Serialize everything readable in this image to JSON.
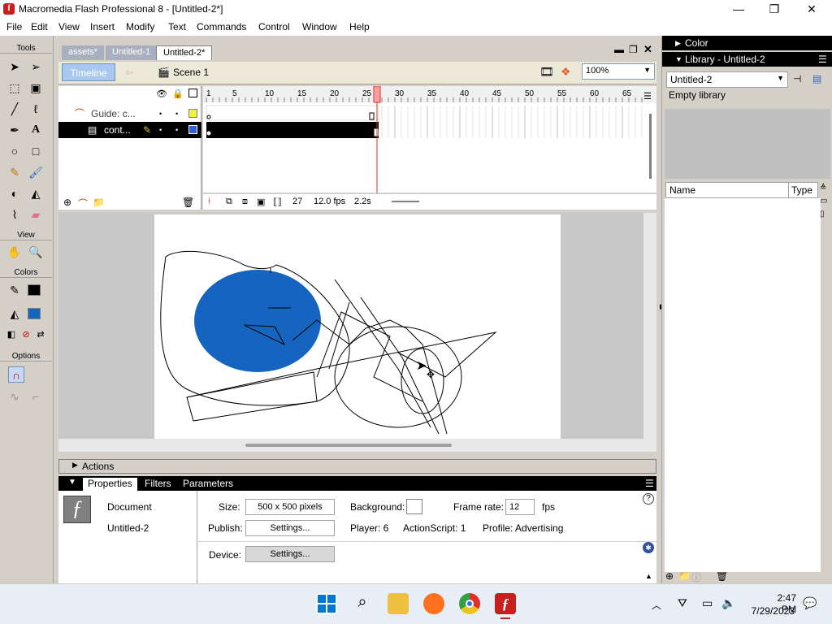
{
  "window": {
    "title": "Macromedia Flash Professional 8 - [Untitled-2*]",
    "minimize": "—",
    "maximize": "❐",
    "close": "✕"
  },
  "menu": [
    "File",
    "Edit",
    "View",
    "Insert",
    "Modify",
    "Text",
    "Commands",
    "Control",
    "Window",
    "Help"
  ],
  "tools": {
    "header": "Tools",
    "view_header": "View",
    "colors_header": "Colors",
    "options_header": "Options"
  },
  "doc_tabs": [
    "assets*",
    "Untitled-1",
    "Untitled-2*"
  ],
  "timeline": {
    "button": "Timeline",
    "scene": "Scene 1",
    "zoom": "100%",
    "ruler": [
      "1",
      "5",
      "10",
      "15",
      "20",
      "25",
      "30",
      "35",
      "40",
      "45",
      "50",
      "55",
      "60",
      "65"
    ],
    "layers": [
      {
        "name": "Guide: c..."
      },
      {
        "name": "cont..."
      }
    ],
    "frame": "27",
    "fps": "12.0 fps",
    "time": "2.2s"
  },
  "actions": "Actions",
  "properties": {
    "tabs": [
      "Properties",
      "Filters",
      "Parameters"
    ],
    "type": "Document",
    "doc_name": "Untitled-2",
    "size_label": "Size:",
    "size_value": "500 x 500 pixels",
    "background_label": "Background:",
    "framerate_label": "Frame rate:",
    "framerate_value": "12",
    "fps": "fps",
    "publish_label": "Publish:",
    "settings": "Settings...",
    "player": "Player: 6",
    "actionscript": "ActionScript: 1",
    "profile": "Profile: Advertising",
    "device_label": "Device:",
    "help": "?"
  },
  "right_panel": {
    "color": "Color",
    "library": "Library - Untitled-2",
    "lib_select": "Untitled-2",
    "empty": "Empty library",
    "col_name": "Name",
    "col_type": "Type"
  },
  "taskbar": {
    "time": "2:47 PM",
    "date": "7/29/2023"
  },
  "colors": {
    "fill": "#1565c0",
    "selection": "#000000",
    "playhead": "#e03030"
  }
}
